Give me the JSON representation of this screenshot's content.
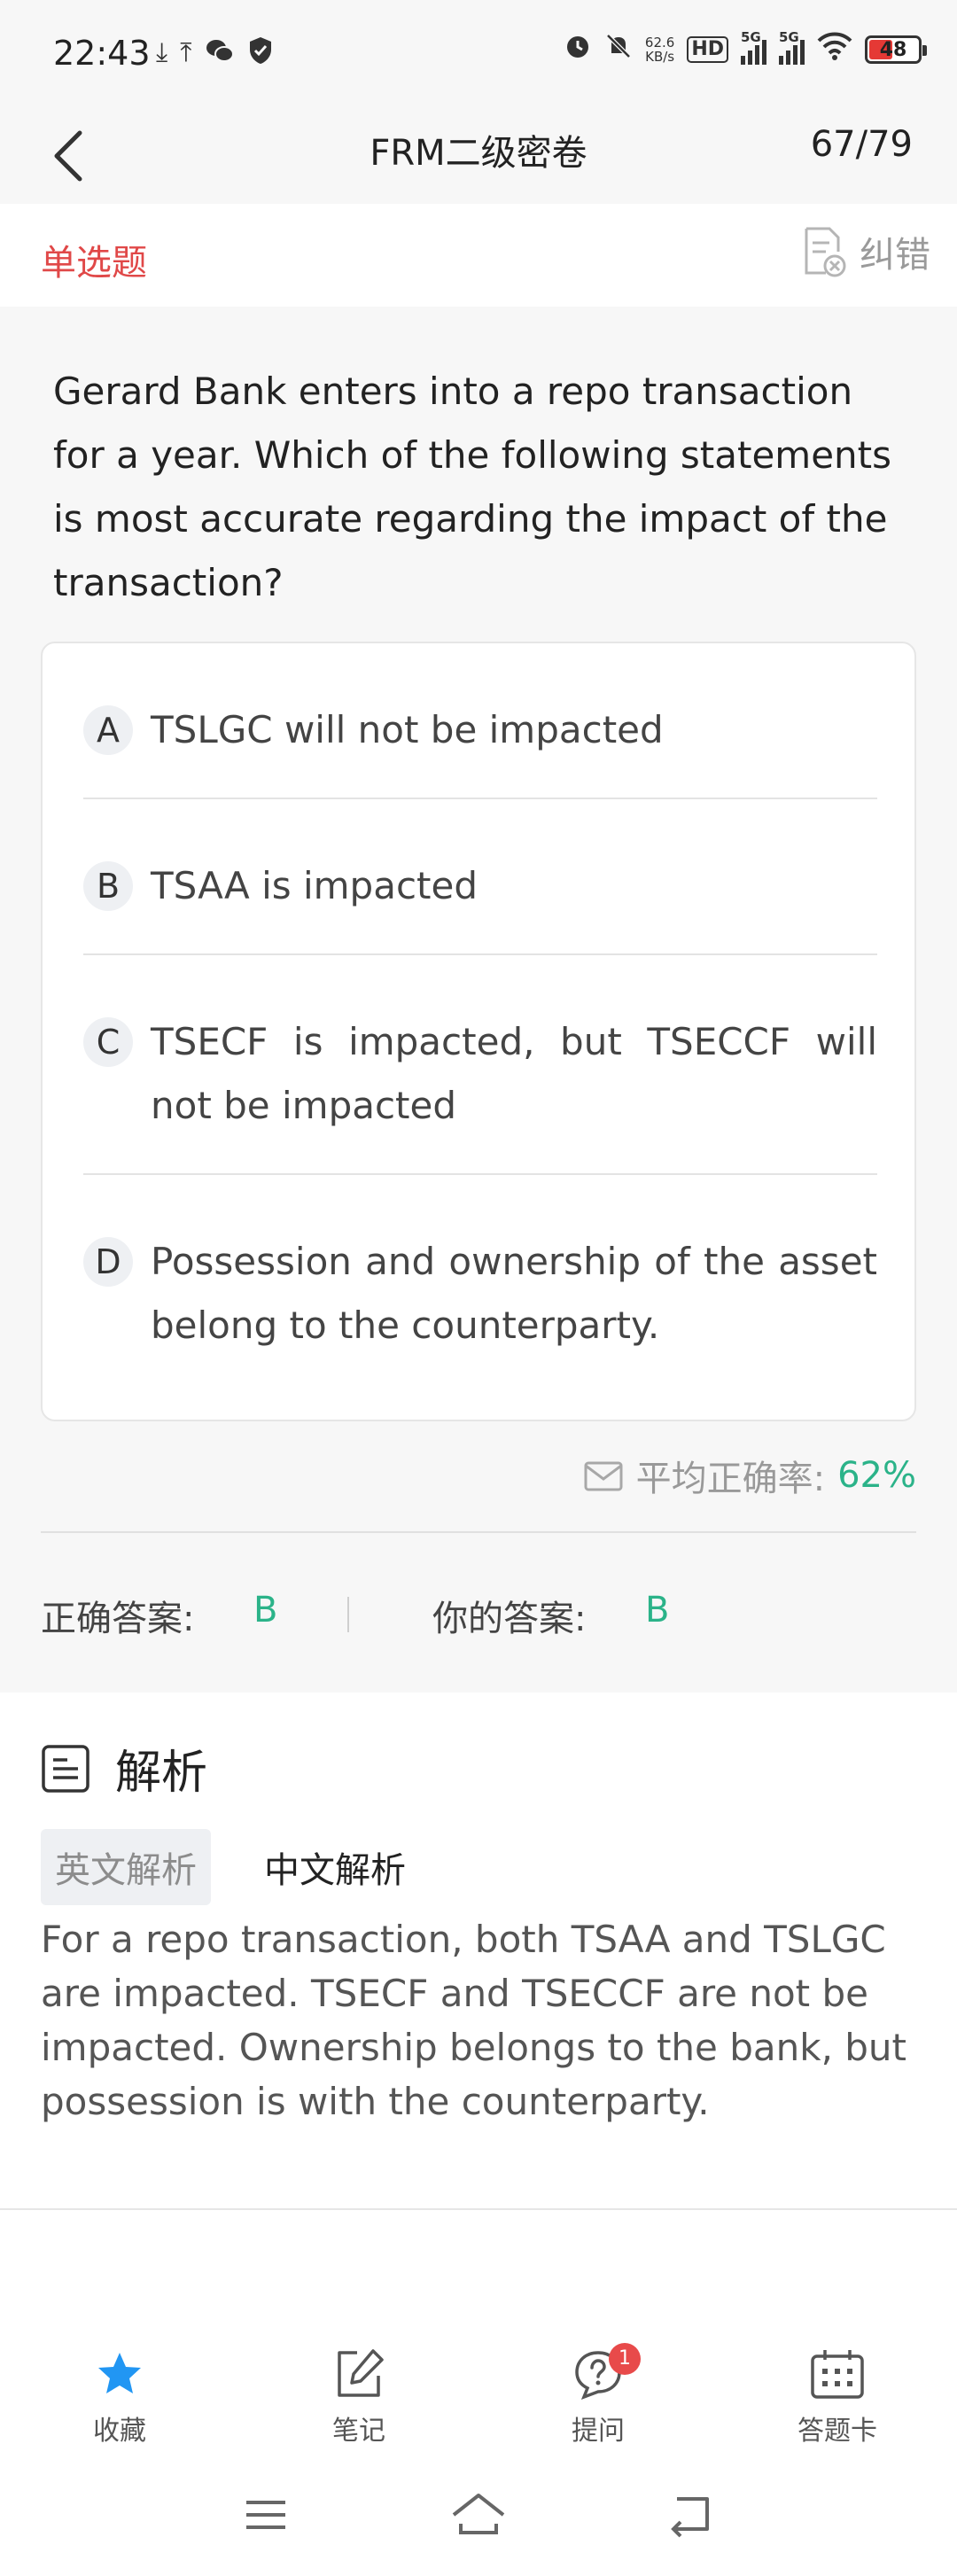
{
  "status_bar": {
    "time": "22:43",
    "net_speed_value": "62.6",
    "net_speed_unit": "KB/s",
    "hd_label": "HD",
    "signal_1_label": "5G",
    "signal_2_label": "5G",
    "battery": "48",
    "icons": [
      "download-icon",
      "upload-icon",
      "wechat-icon",
      "shield-icon",
      "alarm-icon",
      "mute-icon",
      "wifi-icon"
    ]
  },
  "header": {
    "title": "FRM二级密卷",
    "progress": "67/79"
  },
  "question": {
    "type": "单选题",
    "report_label": "纠错",
    "text": "Gerard Bank enters into a repo transaction for a year. Which of the following statements is most accurate regarding the impact of the transaction?",
    "options": [
      {
        "letter": "A",
        "text": "TSLGC will not be impacted"
      },
      {
        "letter": "B",
        "text": "TSAA is impacted"
      },
      {
        "letter": "C",
        "text": "TSECF is impacted, but TSECCF will not be impacted"
      },
      {
        "letter": "D",
        "text": "Possession and ownership of the asset belong to the counterparty."
      }
    ],
    "avg_label": "平均正确率:",
    "avg_value": "62%"
  },
  "answers": {
    "correct_label": "正确答案:",
    "correct_value": "B",
    "yours_label": "你的答案:",
    "yours_value": "B"
  },
  "analysis": {
    "title": "解析",
    "tab_en": "英文解析",
    "tab_cn": "中文解析",
    "text": "For a repo transaction, both TSAA and TSLGC are impacted. TSECF and TSECCF are not be impacted. Ownership belongs to the bank, but possession is with the counterparty."
  },
  "toolbar": {
    "favorite": "收藏",
    "notes": "笔记",
    "ask": "提问",
    "ask_badge": "1",
    "answer_card": "答题卡"
  },
  "colors": {
    "accent_green": "#2bb389",
    "question_type_red": "#e04848",
    "favorite_blue": "#2196f3"
  }
}
